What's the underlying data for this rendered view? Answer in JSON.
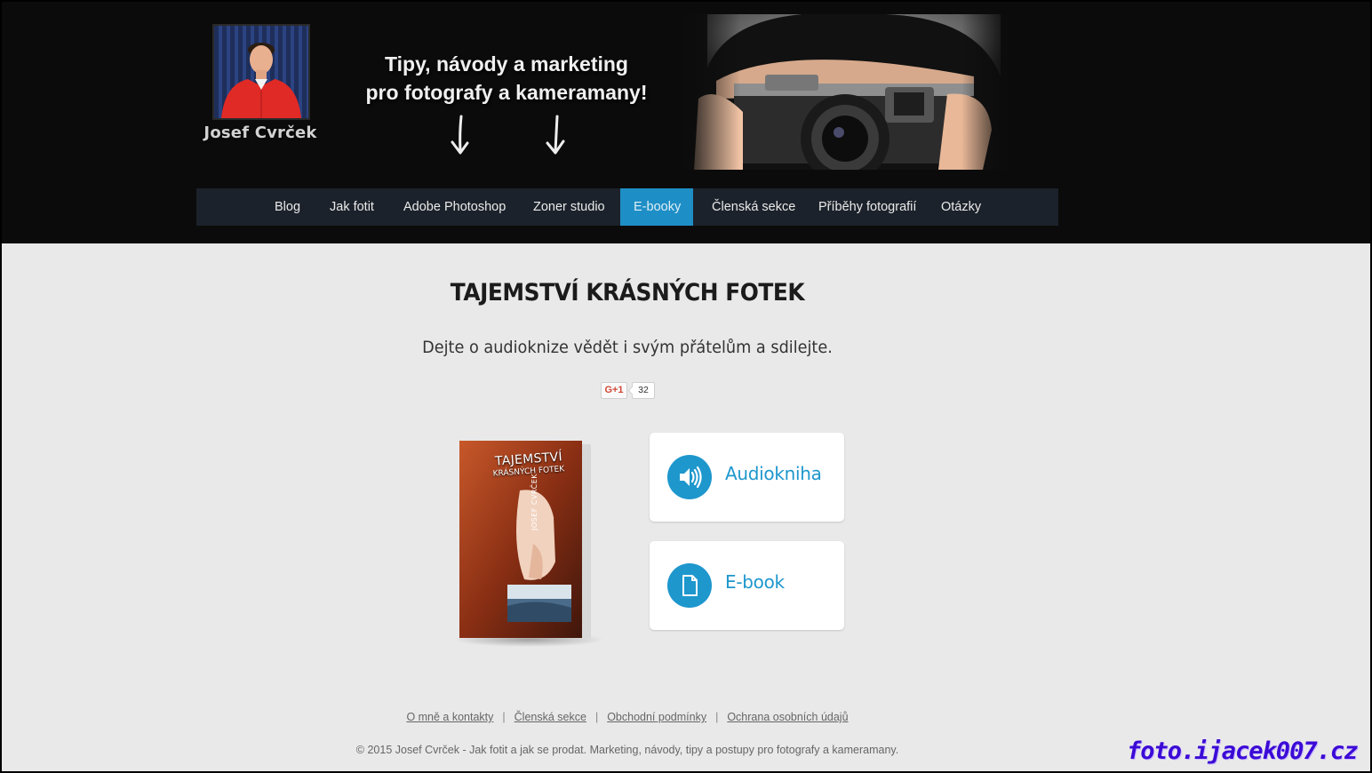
{
  "header": {
    "author_name": "Josef Cvrček",
    "tagline_line1": "Tipy, návody a marketing",
    "tagline_line2": "pro fotografy a kameramany!"
  },
  "nav": {
    "items": [
      {
        "label": "Blog",
        "active": false
      },
      {
        "label": "Jak fotit",
        "active": false
      },
      {
        "label": "Adobe Photoshop",
        "active": false
      },
      {
        "label": "Zoner studio",
        "active": false
      },
      {
        "label": "E-booky",
        "active": true
      },
      {
        "label": "Členská sekce",
        "active": false
      },
      {
        "label": "Příběhy fotografií",
        "active": false
      },
      {
        "label": "Otázky",
        "active": false
      }
    ]
  },
  "main": {
    "title": "TAJEMSTVÍ KRÁSNÝCH FOTEK",
    "share_text": "Dejte o audioknize vědět i svým přátelům a sdilejte.",
    "gplus": {
      "label": "G+1",
      "count": "32"
    },
    "book_cover": {
      "title_line1": "TAJEMSTVÍ",
      "title_line2": "KRÁSNÝCH FOTEK",
      "author": "JOSEF CVRČEK"
    },
    "cards": [
      {
        "label": "Audiokniha",
        "icon": "speaker-icon"
      },
      {
        "label": "E-book",
        "icon": "document-icon"
      }
    ]
  },
  "footer": {
    "links": [
      "O mně a kontakty",
      "Členská sekce",
      "Obchodní podmínky",
      "Ochrana osobních údajů"
    ],
    "separator": "|",
    "copyright": "© 2015 Josef Cvrček - Jak fotit a jak se prodat. Marketing, návody, tipy a postupy pro fotografy a kameramany."
  },
  "watermark": "foto.ijacek007.cz :-)",
  "colors": {
    "accent": "#1e97cd",
    "nav_active": "#1e8fc6",
    "header_bg": "#0b0b0b",
    "nav_bg": "#1c222b",
    "page_bg": "#e9e9e9",
    "watermark": "#3b0ad6"
  }
}
